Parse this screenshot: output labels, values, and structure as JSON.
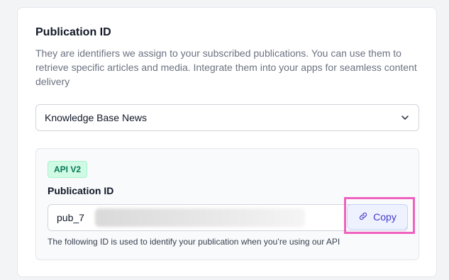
{
  "section": {
    "title": "Publication ID",
    "description": "They are identifiers we assign to your subscribed publications. You can use them to retrieve specific articles and media. Integrate them into your apps for seamless content delivery"
  },
  "publication_select": {
    "selected": "Knowledge Base News",
    "icon": "chevron-down-icon"
  },
  "id_panel": {
    "badge": "API V2",
    "field_label": "Publication ID",
    "value_visible": "pub_7",
    "copy_label": "Copy",
    "copy_icon": "link-icon",
    "helper": "The following ID is used to identify your publication when you’re using our API"
  },
  "colors": {
    "highlight": "#f062c0",
    "badge_bg": "#d1fae5",
    "badge_text": "#047857",
    "copy_text": "#4338ca"
  }
}
